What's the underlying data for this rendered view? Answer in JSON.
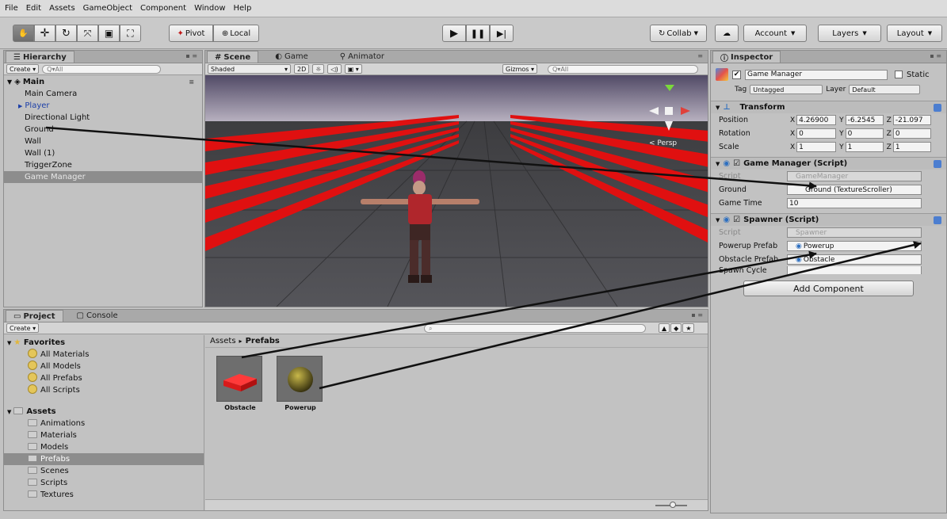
{
  "menu": [
    "File",
    "Edit",
    "Assets",
    "GameObject",
    "Component",
    "Window",
    "Help"
  ],
  "toolbar": {
    "pivot_label": "Pivot",
    "local_label": "Local",
    "collab_label": "Collab",
    "account_label": "Account",
    "layers_label": "Layers",
    "layout_label": "Layout"
  },
  "hierarchy": {
    "tab": "Hierarchy",
    "create_label": "Create",
    "search_placeholder": "Q▾All",
    "scene_name": "Main",
    "items": [
      {
        "label": "Main Camera",
        "selected": false
      },
      {
        "label": "Player",
        "selected": false,
        "expandable": true,
        "color": "#1c3fa8"
      },
      {
        "label": "Directional Light",
        "selected": false
      },
      {
        "label": "Ground",
        "selected": false
      },
      {
        "label": "Wall",
        "selected": false
      },
      {
        "label": "Wall (1)",
        "selected": false
      },
      {
        "label": "TriggerZone",
        "selected": false
      },
      {
        "label": "Game Manager",
        "selected": true
      }
    ]
  },
  "scene": {
    "tabs": [
      "Scene",
      "Game",
      "Animator"
    ],
    "shading": "Shaded",
    "mode_2d": "2D",
    "gizmos_label": "Gizmos",
    "search_placeholder": "Q▾All",
    "persp_label": "< Persp"
  },
  "inspector": {
    "tab": "Inspector",
    "object_name": "Game Manager",
    "static_label": "Static",
    "tag_label": "Tag",
    "tag_value": "Untagged",
    "layer_label": "Layer",
    "layer_value": "Default",
    "transform": {
      "title": "Transform",
      "position": {
        "label": "Position",
        "x": "4.26900",
        "y": "-6.2545",
        "z": "-21.097"
      },
      "rotation": {
        "label": "Rotation",
        "x": "0",
        "y": "0",
        "z": "0"
      },
      "scale": {
        "label": "Scale",
        "x": "1",
        "y": "1",
        "z": "1"
      }
    },
    "game_manager": {
      "title": "Game Manager (Script)",
      "script_label": "Script",
      "script_value": "GameManager",
      "ground_label": "Ground",
      "ground_value": "Ground (TextureScroller)",
      "game_time_label": "Game Time",
      "game_time_value": "10"
    },
    "spawner": {
      "title": "Spawner (Script)",
      "script_label": "Script",
      "script_value": "Spawner",
      "powerup_label": "Powerup Prefab",
      "powerup_value": "Powerup",
      "obstacle_label": "Obstacle Prefab",
      "obstacle_value": "Obstacle",
      "cycle_label": "Spawn Cycle"
    },
    "add_component": "Add Component"
  },
  "project": {
    "tabs": [
      "Project",
      "Console"
    ],
    "create_label": "Create",
    "favorites_label": "Favorites",
    "favorites": [
      "All Materials",
      "All Models",
      "All Prefabs",
      "All Scripts"
    ],
    "assets_label": "Assets",
    "folders": [
      "Animations",
      "Materials",
      "Models",
      "Prefabs",
      "Scenes",
      "Scripts",
      "Textures"
    ],
    "selected_folder": "Prefabs",
    "breadcrumb_root": "Assets",
    "breadcrumb_current": "Prefabs",
    "assets": [
      {
        "name": "Obstacle",
        "kind": "red-box"
      },
      {
        "name": "Powerup",
        "kind": "yellow-sphere"
      }
    ]
  },
  "colors": {
    "accent_selection": "#8d8d8d",
    "bar_red": "#e01010",
    "panel": "#c2c2c2"
  }
}
